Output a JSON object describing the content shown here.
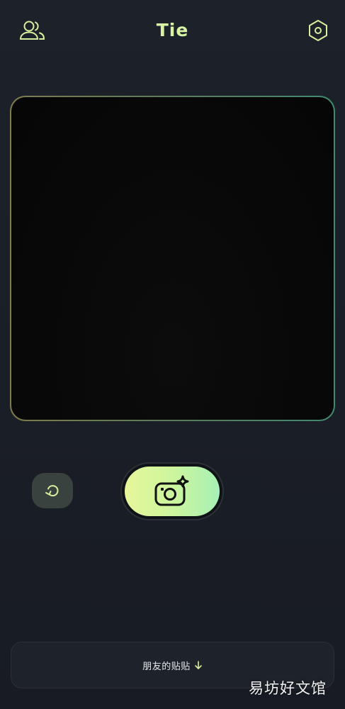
{
  "header": {
    "title": "Tie",
    "friends_icon": "friends-icon",
    "settings_icon": "settings-hexagon-icon"
  },
  "camera": {
    "flip_icon": "flip-camera-icon",
    "shutter_icon": "camera-sparkle-icon"
  },
  "bottom_sheet": {
    "label": "朋友的贴贴",
    "arrow_icon": "arrow-down-icon"
  },
  "watermark": {
    "text": "易坊好文馆"
  },
  "colors": {
    "title": "#d8f3a4",
    "icon_stroke": "#d8ef9e",
    "shutter_gradient_start": "#e8f69a",
    "shutter_gradient_end": "#a7f0b6",
    "background": "#1d2129"
  }
}
